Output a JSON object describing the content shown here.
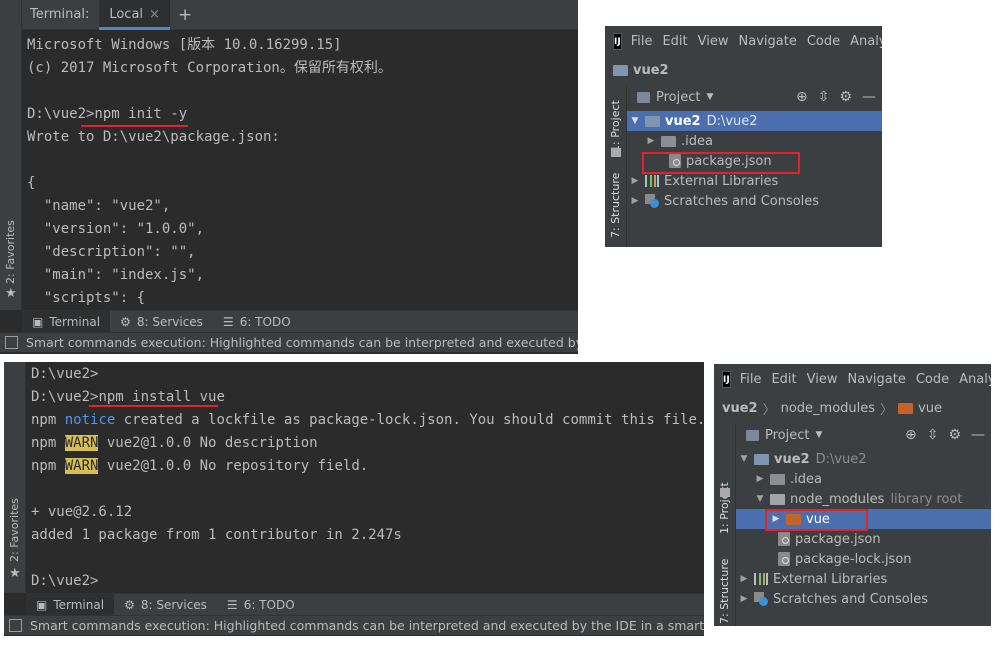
{
  "term1": {
    "tab_label": "Terminal:",
    "tab_name": "Local",
    "close_symbol": "×",
    "add_symbol": "+",
    "lines": [
      "Microsoft Windows [版本 10.0.16299.15]",
      "(c) 2017 Microsoft Corporation。保留所有权利。",
      "",
      "D:\\vue2>npm init -y",
      "Wrote to D:\\vue2\\package.json:",
      "",
      "{",
      "  \"name\": \"vue2\",",
      "  \"version\": \"1.0.0\",",
      "  \"description\": \"\",",
      "  \"main\": \"index.js\",",
      "  \"scripts\": {"
    ],
    "favorites_label": "2: Favorites",
    "bottom_tabs": [
      "Terminal",
      "8: Services",
      "6: TODO"
    ],
    "status_text": "Smart commands execution: Highlighted commands can be interpreted and executed by the IDE"
  },
  "ide1": {
    "menu": [
      "File",
      "Edit",
      "View",
      "Navigate",
      "Code",
      "Analy"
    ],
    "breadcrumb": "vue2",
    "project_label": "Project",
    "side_project": "1: Project",
    "side_structure": "7: Structure",
    "tree": [
      {
        "label": "vue2",
        "extra": "D:\\vue2"
      },
      {
        "label": ".idea"
      },
      {
        "label": "package.json"
      },
      {
        "label": "External Libraries"
      },
      {
        "label": "Scratches and Consoles"
      }
    ]
  },
  "term2": {
    "prompt1": "D:\\vue2>",
    "prompt2_prefix": "D:\\vue2>",
    "prompt2_cmd": "npm install vue",
    "npm": "npm",
    "notice": "notice",
    "notice_rest": " created a lockfile as package-lock.json. You should commit this file.",
    "warn": "WARN",
    "warn1_rest": " vue2@1.0.0 No description",
    "warn2_rest": " vue2@1.0.0 No repository field.",
    "added_version": "+ vue@2.6.12",
    "added_summary": "added 1 package from 1 contributor in 2.247s",
    "prompt_end": "D:\\vue2>",
    "favorites_label": "2: Favorites",
    "bottom_tabs": [
      "Terminal",
      "8: Services",
      "6: TODO"
    ],
    "status_text": "Smart commands execution: Highlighted commands can be interpreted and executed by the IDE in a smart ... (a mir"
  },
  "ide2": {
    "menu": [
      "File",
      "Edit",
      "View",
      "Navigate",
      "Code",
      "Analy"
    ],
    "crumbs": [
      "vue2",
      "node_modules",
      "vue"
    ],
    "project_label": "Project",
    "side_project": "1: Project",
    "side_structure": "7: Structure",
    "tree": [
      {
        "label": "vue2",
        "extra": "D:\\vue2"
      },
      {
        "label": ".idea"
      },
      {
        "label": "node_modules",
        "extra": "library root"
      },
      {
        "label": "vue"
      },
      {
        "label": "package.json"
      },
      {
        "label": "package-lock.json"
      },
      {
        "label": "External Libraries"
      },
      {
        "label": "Scratches and Consoles"
      }
    ]
  },
  "colors": {
    "terminal_bg": "#2b2b2b",
    "ide_bg": "#3c3f41",
    "selection": "#4b6eaf",
    "notice_blue": "#5394ec",
    "warn_bg": "#d6bf55",
    "highlight_red": "#e0242b"
  },
  "icons": {
    "terminal_tab": "terminal-icon",
    "services_tab": "services-icon",
    "todo_tab": "todo-icon",
    "favorites": "star-icon",
    "target": "locate-icon",
    "collapse": "collapse-icon",
    "settings": "gear-icon",
    "hide": "minimize-icon"
  }
}
